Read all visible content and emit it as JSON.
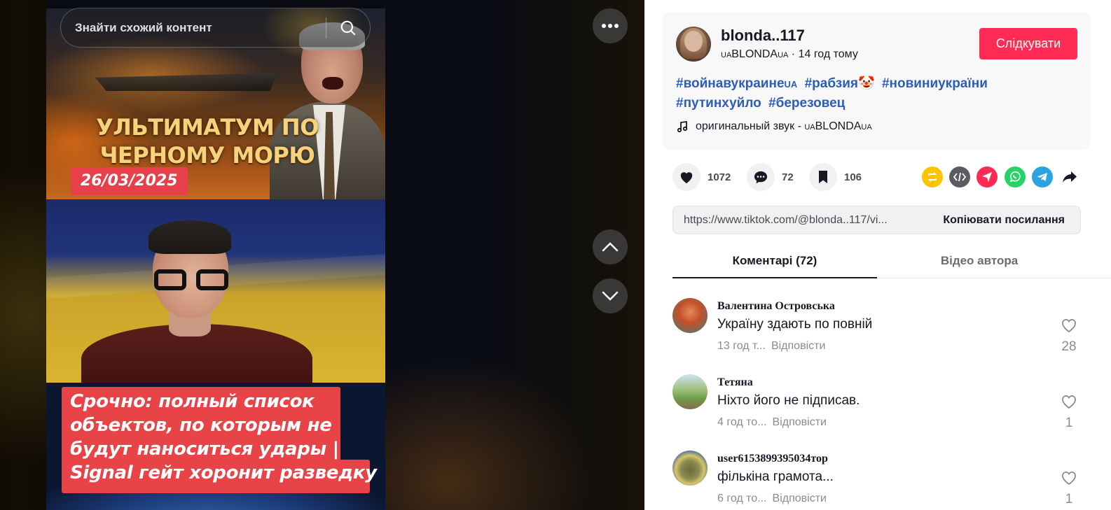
{
  "search": {
    "placeholder": "Знайти схожий контент"
  },
  "video": {
    "headline": "УЛЬТИМАТУМ ПО\nЧЕРНОМУ МОРЮ",
    "date": "26/03/2025",
    "caption": "Срочно: полный список\nобъектов, по которым не\nбудут наноситься удары |\nSignal гейт хоронит разведку"
  },
  "author": {
    "username": "blonda..117",
    "display_prefix": "UA",
    "display_name": "BLONDA",
    "display_suffix": "UA",
    "time": " · 14 год тому",
    "follow_label": "Слідкувати"
  },
  "description": {
    "hashtags": [
      {
        "text": "#войнавукраине",
        "suffix": "UA"
      },
      {
        "text": "#рабзия🤡",
        "suffix": ""
      },
      {
        "text": "#новиниукраїни",
        "suffix": ""
      },
      {
        "text": "#путинхуйло",
        "suffix": ""
      },
      {
        "text": "#березовец",
        "suffix": ""
      }
    ],
    "sound_prefix": "оригинальный звук - ",
    "sound_sc1": "UA",
    "sound_name": "BLONDA",
    "sound_sc2": "UA"
  },
  "stats": {
    "likes": "1072",
    "comments": "72",
    "saves": "106"
  },
  "share_icons": [
    "repost-icon",
    "embed-icon",
    "direct-message-icon",
    "whatsapp-icon",
    "telegram-icon",
    "share-arrow-icon"
  ],
  "link": {
    "url": "https://www.tiktok.com/@blonda..117/vi...",
    "copy_label": "Копіювати посилання"
  },
  "tabs": {
    "comments": "Коментарі (72)",
    "author_videos": "Відео автора"
  },
  "comments": [
    {
      "name": "Валентина Островська",
      "text": "Україну здають по повній",
      "time": "13 год т...",
      "reply": "Відповісти",
      "likes": "28"
    },
    {
      "name": "Тетяна",
      "text": "Ніхто його не підписав.",
      "time": "4 год то...",
      "reply": "Відповісти",
      "likes": "1"
    },
    {
      "name": "user6153899395034тор",
      "text": "фількіна грамота...",
      "time": "6 год то...",
      "reply": "Відповісти",
      "likes": "1"
    }
  ],
  "colors": {
    "accent": "#fe2c55",
    "hashtag": "#2b5db9",
    "repost": "#ffc300",
    "embed": "#5b5b63",
    "dm": "#fe2c55",
    "whatsapp": "#25d366",
    "telegram": "#2aa3e0"
  }
}
